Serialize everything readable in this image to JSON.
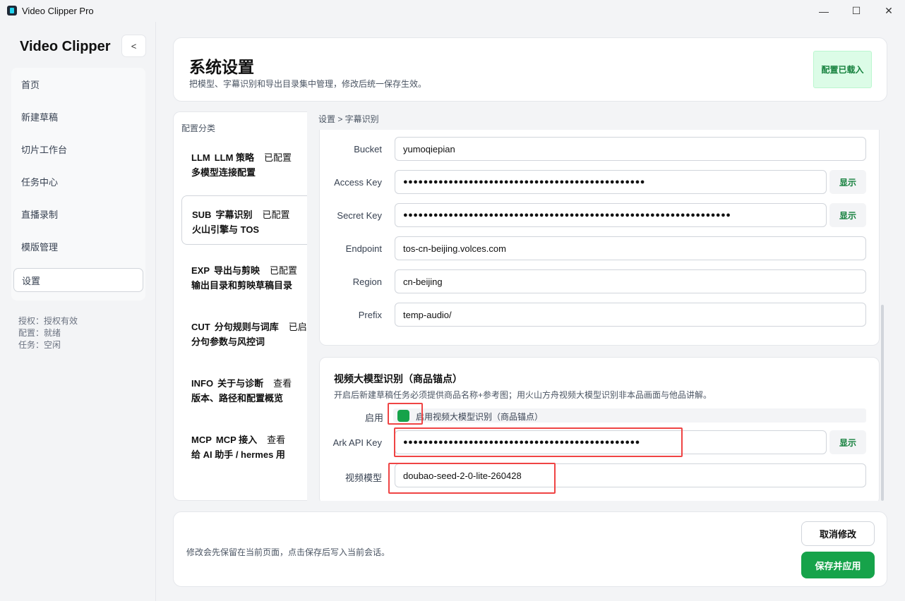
{
  "window": {
    "title": "Video Clipper Pro",
    "minimize": "—",
    "maximize": "☐",
    "close": "✕"
  },
  "sidebar": {
    "brand": "Video Clipper",
    "collapse_label": "<",
    "items": [
      {
        "label": "首页"
      },
      {
        "label": "新建草稿"
      },
      {
        "label": "切片工作台"
      },
      {
        "label": "任务中心"
      },
      {
        "label": "直播录制"
      },
      {
        "label": "模版管理"
      },
      {
        "label": "设置"
      }
    ],
    "status": {
      "license": "授权：授权有效",
      "config": "配置：就绪",
      "task": "任务：空闲"
    }
  },
  "header": {
    "title": "系统设置",
    "subtitle": "把模型、字幕识别和导出目录集中管理，修改后统一保存生效。",
    "badge": "配置已载入"
  },
  "categories": {
    "label": "配置分类",
    "items": [
      {
        "code": "LLM",
        "name": "LLM 策略",
        "status": "已配置",
        "desc": "多模型连接配置"
      },
      {
        "code": "SUB",
        "name": "字幕识别",
        "status": "已配置",
        "desc": "火山引擎与 TOS"
      },
      {
        "code": "EXP",
        "name": "导出与剪映",
        "status": "已配置",
        "desc": "输出目录和剪映草稿目录"
      },
      {
        "code": "CUT",
        "name": "分句规则与词库",
        "status": "已启",
        "desc": "分句参数与风控词"
      },
      {
        "code": "INFO",
        "name": "关于与诊断",
        "status": "查看",
        "desc": "版本、路径和配置概览"
      },
      {
        "code": "MCP",
        "name": "MCP 接入",
        "status": "查看",
        "desc": "给 AI 助手 / hermes 用"
      }
    ]
  },
  "breadcrumb": "设置 > 字幕识别",
  "tos": {
    "bucket": {
      "label": "Bucket",
      "value": "yumoqiepian"
    },
    "access_key": {
      "label": "Access Key",
      "value": "●●●●●●●●●●●●●●●●●●●●●●●●●●●●●●●●●●●●●●●●●●●●●●●●",
      "show": "显示"
    },
    "secret_key": {
      "label": "Secret Key",
      "value": "●●●●●●●●●●●●●●●●●●●●●●●●●●●●●●●●●●●●●●●●●●●●●●●●●●●●●●●●●●●●●●●●●",
      "show": "显示"
    },
    "endpoint": {
      "label": "Endpoint",
      "value": "tos-cn-beijing.volces.com"
    },
    "region": {
      "label": "Region",
      "value": "cn-beijing"
    },
    "prefix": {
      "label": "Prefix",
      "value": "temp-audio/"
    }
  },
  "video_model": {
    "title": "视频大模型识别（商品锚点）",
    "desc": "开启后新建草稿任务必须提供商品名称+参考图；用火山方舟视频大模型识别非本品画面与他品讲解。",
    "enable_label": "启用",
    "enable_text": "启用视频大模型识别（商品锚点）",
    "enabled": true,
    "ark_key": {
      "label": "Ark API Key",
      "value": "●●●●●●●●●●●●●●●●●●●●●●●●●●●●●●●●●●●●●●●●●●●●●●●",
      "show": "显示"
    },
    "model": {
      "label": "视频模型",
      "value": "doubao-seed-2-0-lite-260428"
    }
  },
  "footer": {
    "note": "修改会先保留在当前页面，点击保存后写入当前会话。",
    "cancel": "取消修改",
    "save": "保存并应用"
  },
  "colors": {
    "accent_green": "#16a34a",
    "highlight_red": "#ef4444",
    "badge_bg": "#dcfce7"
  }
}
